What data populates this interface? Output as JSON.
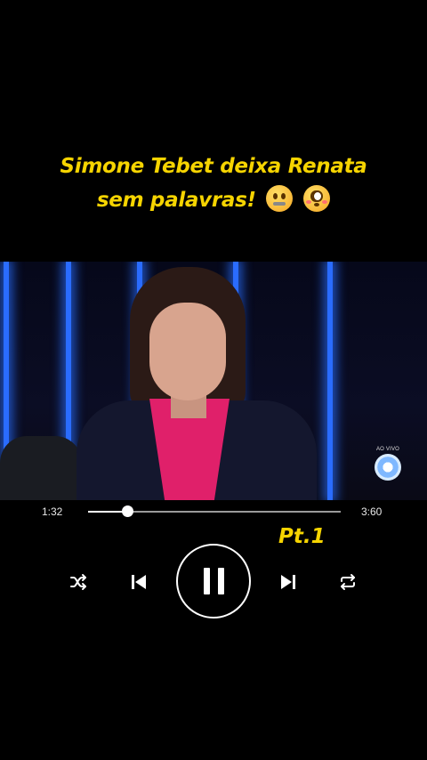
{
  "caption": {
    "line1": "Simone Tebet deixa Renata",
    "line2": "sem palavras!",
    "emojis": [
      "zipper-mouth-face",
      "flushed-face"
    ]
  },
  "video": {
    "broadcaster_badge": "AO VIVO",
    "logo": "globo-icon"
  },
  "player": {
    "current_time": "1:32",
    "total_time": "3:60",
    "progress": 0.155,
    "part_label": "Pt.1",
    "state": "playing",
    "controls": [
      "shuffle-icon",
      "previous-icon",
      "pause-icon",
      "next-icon",
      "repeat-icon"
    ]
  },
  "colors": {
    "accent_yellow": "#f6d400",
    "studio_blue": "#2a6cff",
    "background": "#000000"
  }
}
